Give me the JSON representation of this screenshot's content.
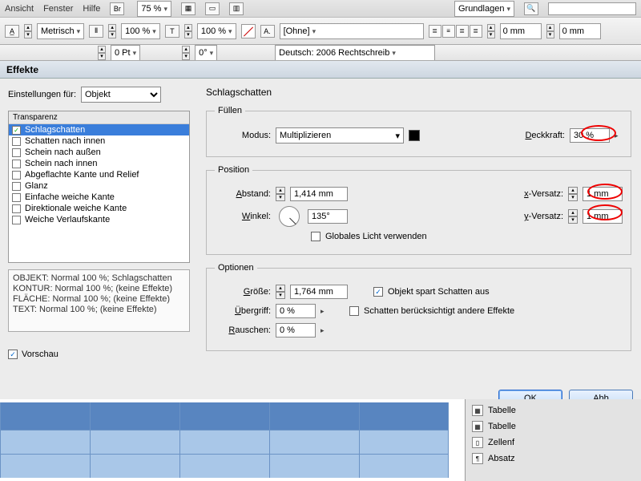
{
  "menubar": {
    "items": [
      "Ansicht",
      "Fenster",
      "Hilfe"
    ],
    "brand": "Br",
    "zoom": "75 %",
    "right_label": "Grundlagen"
  },
  "toolbar": {
    "scale_mode": "Metrisch",
    "scale1": "100 %",
    "scale2": "100 %",
    "pt": "0 Pt",
    "deg": "0°",
    "style": "[Ohne]",
    "lang": "Deutsch: 2006 Rechtschreib",
    "mm1": "0 mm",
    "mm2": "0 mm"
  },
  "dialog": {
    "title": "Effekte",
    "settings_label": "Einstellungen für:",
    "settings_value": "Objekt",
    "effect_header": "Transparenz",
    "effects": [
      {
        "label": "Schlagschatten",
        "checked": true,
        "selected": true
      },
      {
        "label": "Schatten nach innen",
        "checked": false
      },
      {
        "label": "Schein nach außen",
        "checked": false
      },
      {
        "label": "Schein nach innen",
        "checked": false
      },
      {
        "label": "Abgeflachte Kante und Relief",
        "checked": false
      },
      {
        "label": "Glanz",
        "checked": false
      },
      {
        "label": "Einfache weiche Kante",
        "checked": false
      },
      {
        "label": "Direktionale weiche Kante",
        "checked": false
      },
      {
        "label": "Weiche Verlaufskante",
        "checked": false
      }
    ],
    "info": [
      "OBJEKT: Normal 100 %; Schlagschatten",
      "KONTUR: Normal 100 %; (keine Effekte)",
      "FLÄCHE: Normal 100 %; (keine Effekte)",
      "TEXT: Normal 100 %; (keine Effekte)"
    ],
    "preview_label": "Vorschau",
    "panel_title": "Schlagschatten",
    "fill": {
      "legend": "Füllen",
      "mode_label": "Modus:",
      "mode_value": "Multiplizieren",
      "opacity_label": "Deckkraft:",
      "opacity_value": "30 %"
    },
    "position": {
      "legend": "Position",
      "distance_label": "Abstand:",
      "distance_value": "1,414 mm",
      "angle_label": "Winkel:",
      "angle_value": "135°",
      "global_light": "Globales Licht verwenden",
      "x_label": "x-Versatz:",
      "x_value": "1 mm",
      "y_label": "y-Versatz:",
      "y_value": "1 mm"
    },
    "options": {
      "legend": "Optionen",
      "size_label": "Größe:",
      "size_value": "1,764 mm",
      "spread_label": "Übergriff:",
      "spread_value": "0 %",
      "noise_label": "Rauschen:",
      "noise_value": "0 %",
      "knockout": "Objekt spart Schatten aus",
      "honors": "Schatten berücksichtigt andere Effekte"
    },
    "ok": "OK",
    "cancel": "Abb"
  },
  "rightPanel": {
    "items": [
      "Tabelle",
      "Tabelle",
      "Zellenf",
      "Absatz"
    ]
  }
}
